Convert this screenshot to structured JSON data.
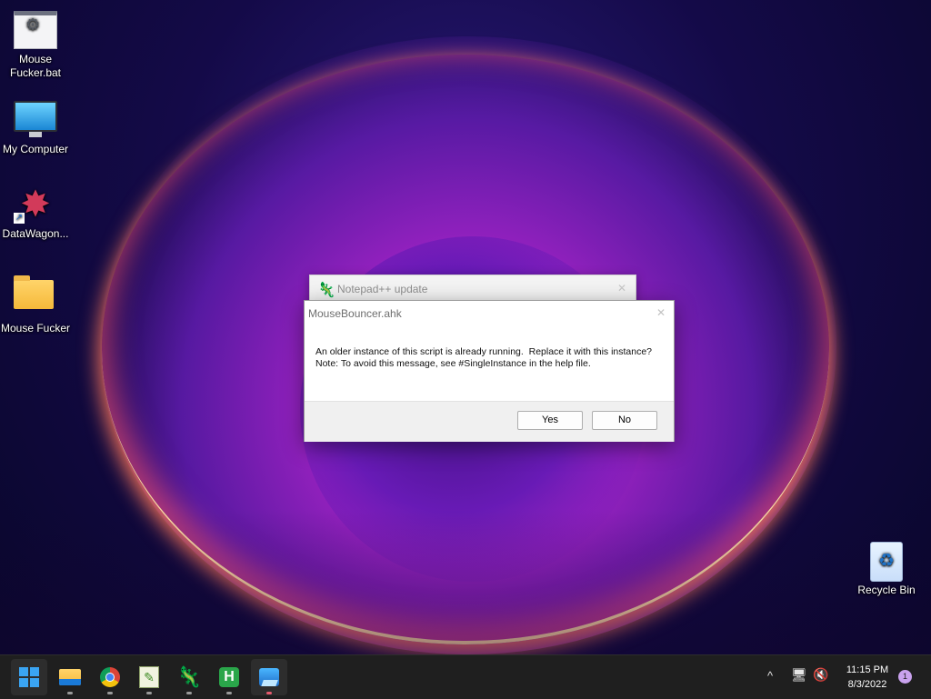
{
  "desktop": {
    "icons": [
      {
        "label": "Mouse Fucker.bat",
        "icon": "batch-file-icon"
      },
      {
        "label": "My Computer",
        "icon": "monitor-icon"
      },
      {
        "label": "DataWagon...",
        "icon": "datawagon-shortcut-icon"
      },
      {
        "label": "Mouse Fucker",
        "icon": "folder-icon"
      },
      {
        "label": "Recycle Bin",
        "icon": "recycle-bin-icon"
      }
    ]
  },
  "background_window": {
    "title": "Notepad++ update",
    "icon": "notepadpp-lizard-icon",
    "close_glyph": "✕"
  },
  "dialog": {
    "title": "MouseBouncer.ahk",
    "close_glyph": "✕",
    "message_line1": "An older instance of this script is already running.  Replace it with this instance?",
    "message_line2": "Note: To avoid this message, see #SingleInstance in the help file.",
    "yes_label": "Yes",
    "no_label": "No"
  },
  "taskbar": {
    "items": [
      "start-button",
      "file-explorer",
      "chrome",
      "notepadpp",
      "notepadpp-lizard",
      "h-app",
      "photos"
    ],
    "h_glyph": "H",
    "tray": {
      "chevron_glyph": "^",
      "network_glyph": "🖥",
      "volume_glyph": "🔇",
      "time": "11:15 PM",
      "date": "8/3/2022",
      "notification_count": "1"
    }
  },
  "colors": {
    "dialog_bg": "#ffffff",
    "taskbar_bg": "#1f1f1f",
    "accent": "#3aa4f2",
    "notification_badge": "#c9a2ee"
  }
}
